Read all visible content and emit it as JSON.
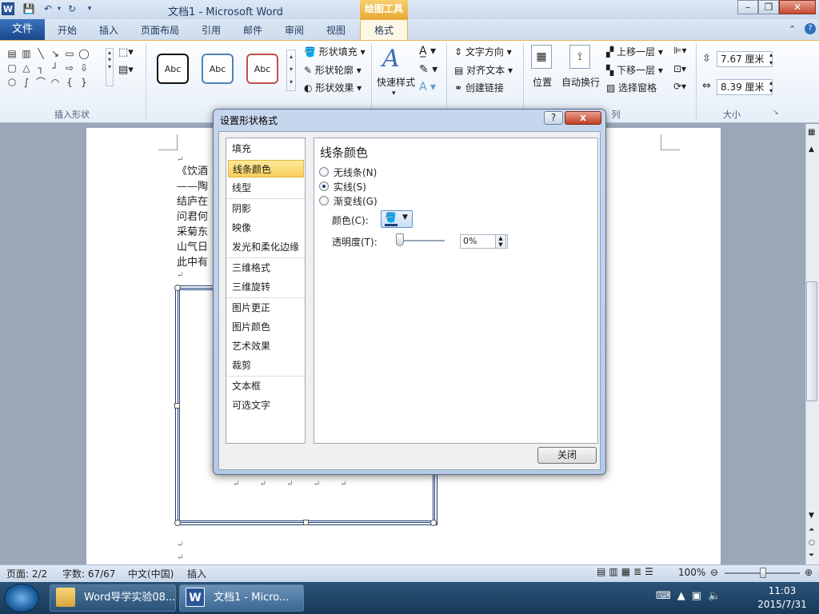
{
  "window": {
    "title": "文档1 - Microsoft Word",
    "context_tools": "绘图工具",
    "app_letter": "W"
  },
  "tabs": {
    "file": "文件",
    "items": [
      "开始",
      "插入",
      "页面布局",
      "引用",
      "邮件",
      "审阅",
      "视图"
    ],
    "format": "格式"
  },
  "ribbon": {
    "insert_shapes_label": "插入形状",
    "style_samples": [
      "Abc",
      "Abc",
      "Abc"
    ],
    "shape_fill": "形状填充",
    "shape_outline": "形状轮廓",
    "shape_effects": "形状效果",
    "quick_styles": "快速样式",
    "text_direction": "文字方向",
    "align_text": "对齐文本",
    "create_link": "创建链接",
    "position": "位置",
    "wrap_text": "自动换行",
    "bring_forward": "上移一层",
    "send_backward": "下移一层",
    "selection_pane": "选择窗格",
    "arrange_label": "列",
    "height": "7.67 厘米",
    "width": "8.39 厘米",
    "size_label": "大小"
  },
  "document": {
    "lines": [
      "《饮酒",
      "——陶",
      "结庐在",
      "问君何",
      "采菊东",
      "山气日",
      "此中有"
    ],
    "para_mark": "↵",
    "frame_marks": [
      "↵",
      "↵",
      "↵",
      "↵",
      "↵"
    ]
  },
  "dialog": {
    "title": "设置形状格式",
    "help": "?",
    "close_x": "x",
    "nav": [
      "填充",
      "线条颜色",
      "线型",
      "阴影",
      "映像",
      "发光和柔化边缘",
      "三维格式",
      "三维旋转",
      "图片更正",
      "图片颜色",
      "艺术效果",
      "裁剪",
      "文本框",
      "可选文字"
    ],
    "selected_index": 1,
    "heading": "线条颜色",
    "options": [
      "无线条(N)",
      "实线(S)",
      "渐变线(G)"
    ],
    "selected_option": 1,
    "color_label": "颜色(C):",
    "transparency_label": "透明度(T):",
    "transparency_value": "0%",
    "close_button": "关闭"
  },
  "status": {
    "page": "页面: 2/2",
    "words": "字数: 67/67",
    "language": "中文(中国)",
    "mode": "插入",
    "zoom": "100%"
  },
  "taskbar": {
    "items": [
      "Word导学实验08...",
      "文档1 - Micro..."
    ],
    "time": "11:03",
    "date": "2015/7/31"
  },
  "colors": {
    "accent": "#2b579a",
    "context": "#e9a932",
    "selected_nav": "#f8cf5a",
    "outline_color": "#1c3f78"
  }
}
